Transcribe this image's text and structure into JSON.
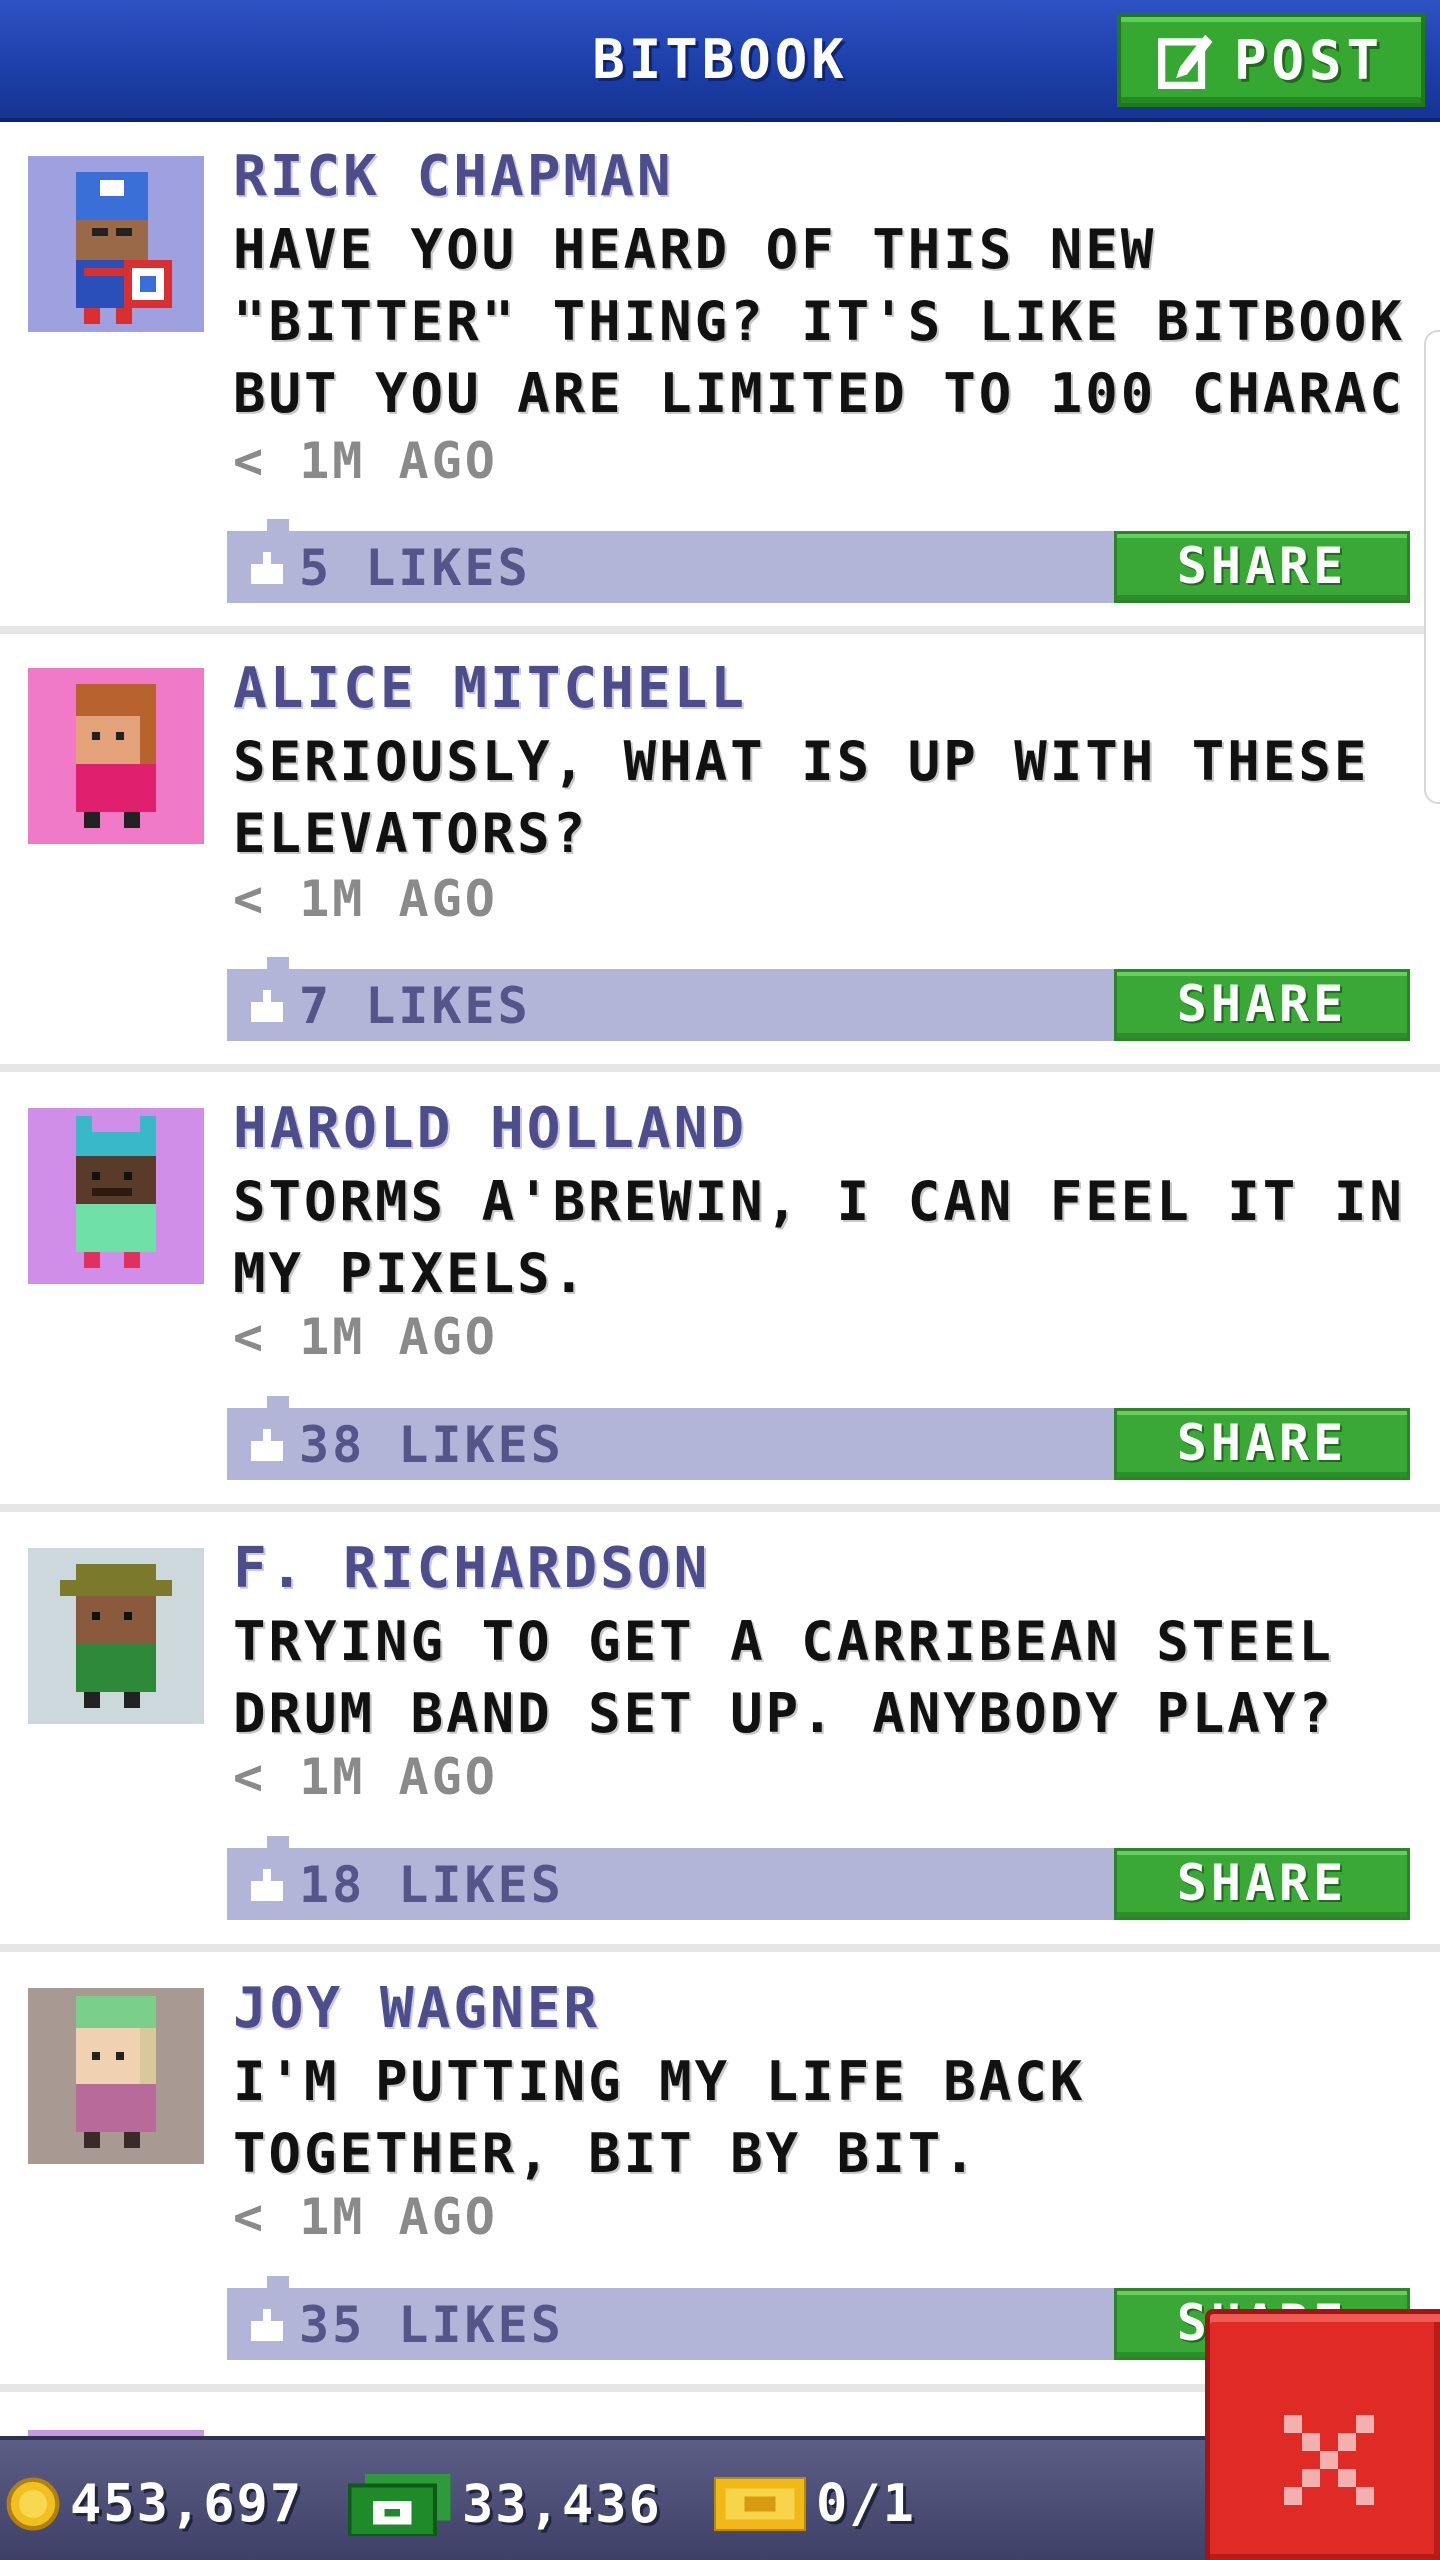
{
  "header": {
    "title": "BITBOOK",
    "post_label": "POST"
  },
  "posts": [
    {
      "author": "RICK CHAPMAN",
      "message": "HAVE YOU HEARD OF THIS NEW \"BITTER\" THING? IT'S LIKE BITBOOK BUT YOU ARE LIMITED TO 100 CHARAC",
      "time": "< 1M AGO",
      "likes": "5 LIKES",
      "share_label": "SHARE",
      "avatar_bg": "#9fa0e0"
    },
    {
      "author": "ALICE MITCHELL",
      "message": "SERIOUSLY, WHAT IS UP WITH THESE ELEVATORS?",
      "time": "< 1M AGO",
      "likes": "7 LIKES",
      "share_label": "SHARE",
      "avatar_bg": "#f07ac8"
    },
    {
      "author": "HAROLD HOLLAND",
      "message": "STORMS A'BREWIN, I CAN FEEL IT IN MY PIXELS.",
      "time": "< 1M AGO",
      "likes": "38 LIKES",
      "share_label": "SHARE",
      "avatar_bg": "#d08ee8"
    },
    {
      "author": "F. RICHARDSON",
      "message": "TRYING TO GET A CARRIBEAN STEEL DRUM BAND SET UP. ANYBODY PLAY?",
      "time": "< 1M AGO",
      "likes": "18 LIKES",
      "share_label": "SHARE",
      "avatar_bg": "#ccd8dc"
    },
    {
      "author": "JOY WAGNER",
      "message": "I'M PUTTING MY LIFE BACK TOGETHER, BIT BY BIT.",
      "time": "< 1M AGO",
      "likes": "35 LIKES",
      "share_label": "SHARE",
      "avatar_bg": "#a89a92"
    }
  ],
  "statusbar": {
    "coins": "453,697",
    "bux": "33,436",
    "tickets": "0/1"
  },
  "icons": {
    "post": "edit-icon",
    "likes": "thumbs-up-icon",
    "coins": "coin-icon",
    "bux": "bux-icon",
    "tickets": "ticket-icon",
    "close": "close-icon"
  },
  "colors": {
    "header": "#1c3ea8",
    "accent_green": "#35a832",
    "likes_bar": "#b3b5d8",
    "author": "#4d4d8c",
    "close": "#e02a25"
  }
}
